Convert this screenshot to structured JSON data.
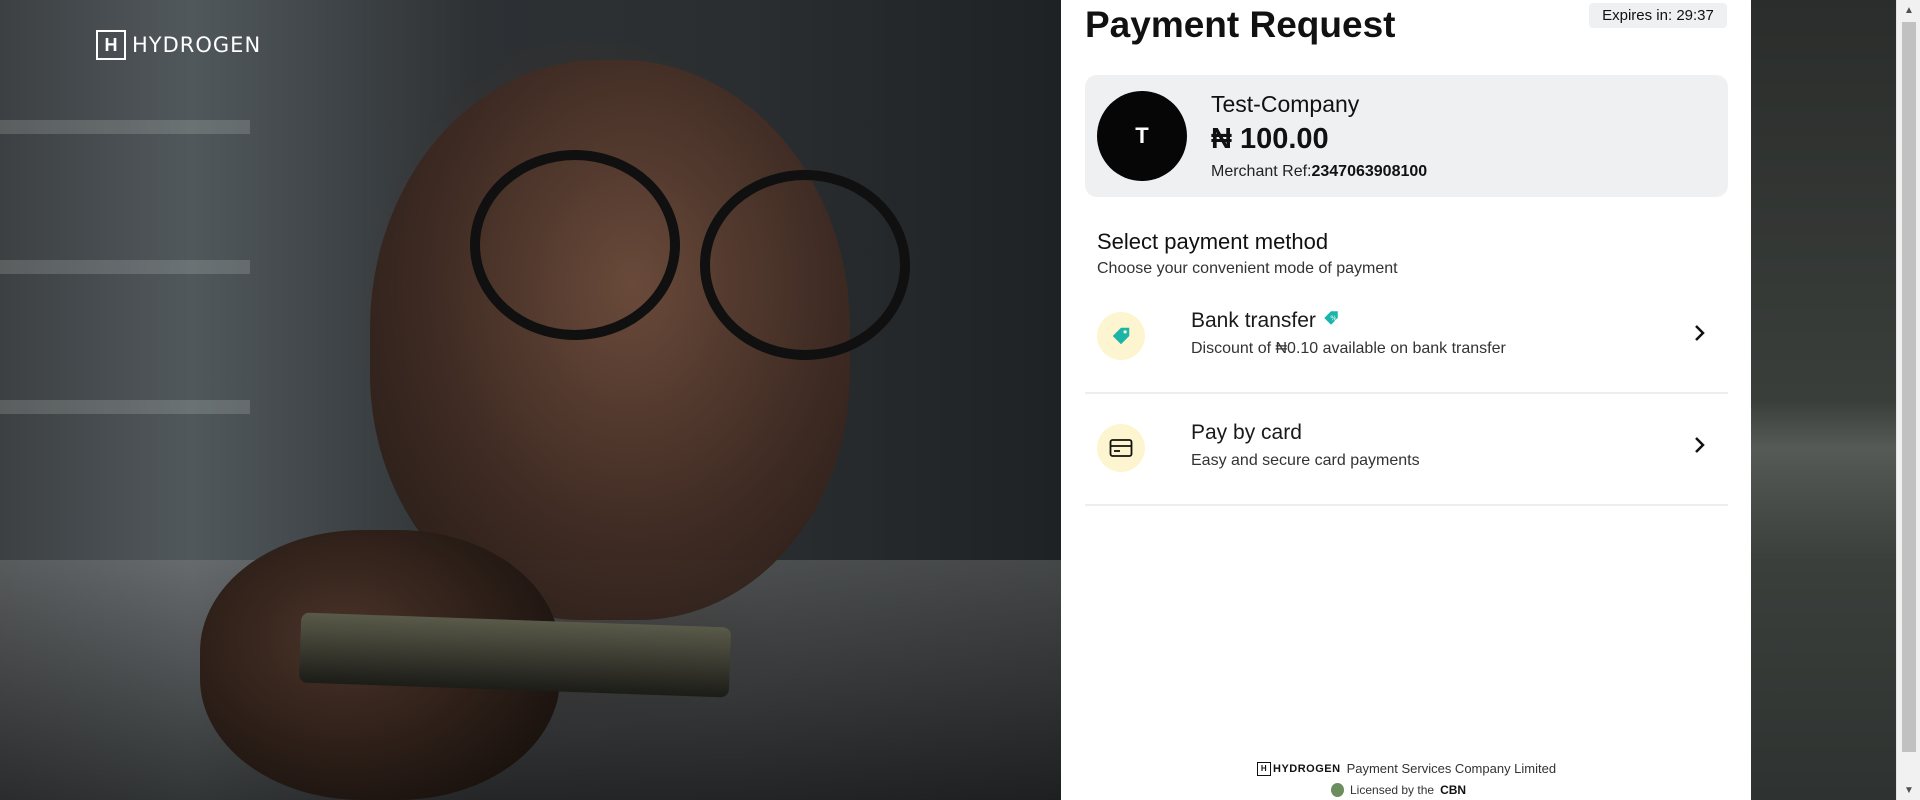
{
  "brand": {
    "logo_text": "HYDROGEN",
    "logo_mark": "H"
  },
  "page": {
    "title": "Payment Request",
    "expires": "Expires in: 29:37"
  },
  "merchant": {
    "initial": "T",
    "name": "Test-Company",
    "currency_symbol": "₦",
    "amount": "100.00",
    "ref_label": "Merchant Ref:",
    "ref_value": "2347063908100"
  },
  "payment": {
    "title": "Select payment method",
    "subtitle": "Choose your convenient mode of payment",
    "methods": [
      {
        "title": "Bank transfer",
        "subtitle": "Discount of ₦0.10 available on bank transfer",
        "icon": "tag-icon",
        "badge_icon": "discount-tag-icon"
      },
      {
        "title": "Pay by card",
        "subtitle": "Easy and secure card payments",
        "icon": "credit-card-icon"
      }
    ]
  },
  "footer": {
    "company": "Payment Services Company Limited",
    "licensed_prefix": "Licensed by the",
    "licensed_by": "CBN"
  },
  "colors": {
    "accent_icon_bg": "#fdf5cf",
    "tag_teal": "#1ab5a8",
    "card_bg": "#eff0f2"
  }
}
